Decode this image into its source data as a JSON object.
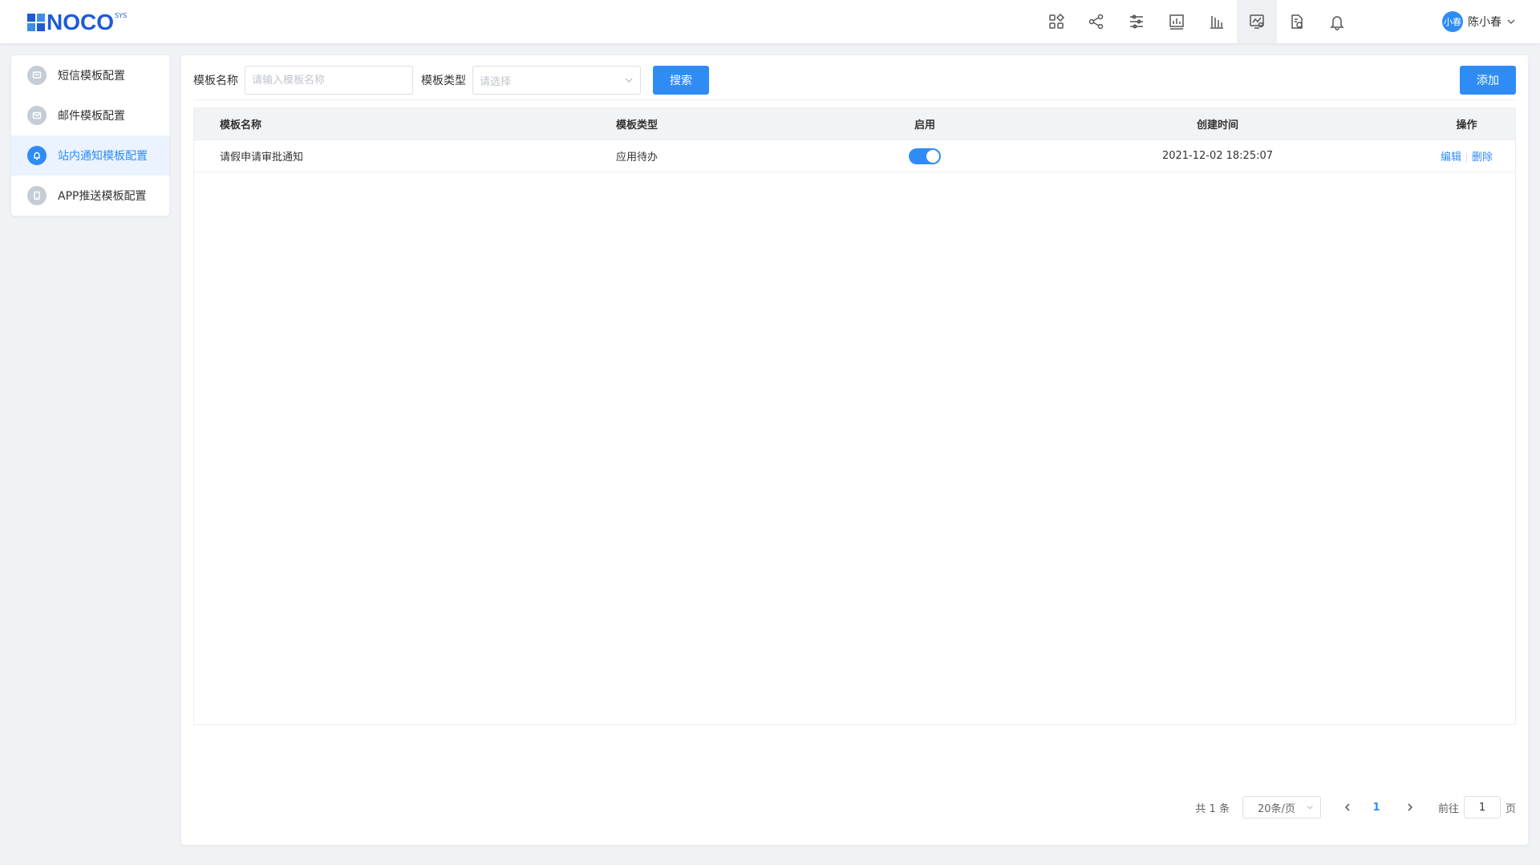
{
  "app": {
    "logo_text": "NOCO",
    "logo_sup": "SYS"
  },
  "header": {
    "icons": [
      "apps-icon",
      "share-icon",
      "sliders-icon",
      "bar-chart-icon",
      "analytics-icon",
      "monitor-settings-icon",
      "document-settings-icon",
      "bell-icon"
    ],
    "active_icon": "monitor-settings-icon",
    "user": {
      "avatar_text": "小春",
      "name": "陈小春"
    }
  },
  "sidebar": {
    "items": [
      {
        "label": "短信模板配置",
        "icon": "message-icon",
        "active": false
      },
      {
        "label": "邮件模板配置",
        "icon": "mail-icon",
        "active": false
      },
      {
        "label": "站内通知模板配置",
        "icon": "bell-icon",
        "active": true
      },
      {
        "label": "APP推送模板配置",
        "icon": "phone-icon",
        "active": false
      }
    ]
  },
  "toolbar": {
    "name_label": "模板名称",
    "name_placeholder": "请输入模板名称",
    "type_label": "模板类型",
    "type_placeholder": "请选择",
    "search_label": "搜索",
    "add_label": "添加"
  },
  "table": {
    "columns": [
      "模板名称",
      "模板类型",
      "启用",
      "创建时间",
      "操作"
    ],
    "rows": [
      {
        "name": "请假申请审批通知",
        "type": "应用待办",
        "enabled": true,
        "created": "2021-12-02 18:25:07",
        "edit": "编辑",
        "delete": "删除"
      }
    ]
  },
  "pagination": {
    "total": "共 1 条",
    "page_size": "20条/页",
    "current_page": "1",
    "goto_label": "前往",
    "goto_value": "1",
    "page_unit": "页"
  },
  "colors": {
    "accent": "#2f8cf5",
    "logo": "#1e5bd6"
  }
}
